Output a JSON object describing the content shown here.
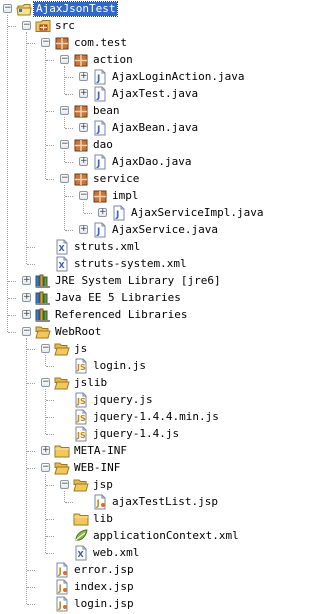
{
  "tree": {
    "items": [
      {
        "label": "AjaxJsonTest",
        "depth": 0,
        "icon": "project-icon",
        "expanded": true,
        "selected": true,
        "last": false
      },
      {
        "label": "src",
        "depth": 1,
        "icon": "source-folder-icon",
        "expanded": true,
        "last": false
      },
      {
        "label": "com.test",
        "depth": 2,
        "icon": "package-icon",
        "expanded": true,
        "last": false
      },
      {
        "label": "action",
        "depth": 3,
        "icon": "package-icon",
        "expanded": true,
        "last": false
      },
      {
        "label": "AjaxLoginAction.java",
        "depth": 4,
        "icon": "java-file-icon",
        "expanded": false,
        "last": false
      },
      {
        "label": "AjaxTest.java",
        "depth": 4,
        "icon": "java-file-icon",
        "expanded": false,
        "last": true
      },
      {
        "label": "bean",
        "depth": 3,
        "icon": "package-icon",
        "expanded": true,
        "last": false
      },
      {
        "label": "AjaxBean.java",
        "depth": 4,
        "icon": "java-file-icon",
        "expanded": false,
        "last": true
      },
      {
        "label": "dao",
        "depth": 3,
        "icon": "package-icon",
        "expanded": true,
        "last": false
      },
      {
        "label": "AjaxDao.java",
        "depth": 4,
        "icon": "java-file-icon",
        "expanded": false,
        "last": true
      },
      {
        "label": "service",
        "depth": 3,
        "icon": "package-icon",
        "expanded": true,
        "last": true
      },
      {
        "label": "impl",
        "depth": 4,
        "icon": "package-icon",
        "expanded": true,
        "last": false
      },
      {
        "label": "AjaxServiceImpl.java",
        "depth": 5,
        "icon": "java-file-icon",
        "expanded": false,
        "last": true
      },
      {
        "label": "AjaxService.java",
        "depth": 4,
        "icon": "java-file-icon",
        "expanded": false,
        "last": true
      },
      {
        "label": "struts.xml",
        "depth": 2,
        "icon": "xml-file-icon",
        "expanded": null,
        "last": false
      },
      {
        "label": "struts-system.xml",
        "depth": 2,
        "icon": "xml-file-icon",
        "expanded": null,
        "last": true
      },
      {
        "label": "JRE System Library [jre6]",
        "depth": 1,
        "icon": "library-icon",
        "expanded": false,
        "last": false
      },
      {
        "label": "Java EE 5 Libraries",
        "depth": 1,
        "icon": "library-icon",
        "expanded": false,
        "last": false
      },
      {
        "label": "Referenced Libraries",
        "depth": 1,
        "icon": "library-icon",
        "expanded": false,
        "last": false
      },
      {
        "label": "WebRoot",
        "depth": 1,
        "icon": "folder-open-icon",
        "expanded": true,
        "last": true
      },
      {
        "label": "js",
        "depth": 2,
        "icon": "folder-open-icon",
        "expanded": true,
        "last": false
      },
      {
        "label": "login.js",
        "depth": 3,
        "icon": "js-file-icon",
        "expanded": null,
        "last": true
      },
      {
        "label": "jslib",
        "depth": 2,
        "icon": "folder-open-icon",
        "expanded": true,
        "last": false
      },
      {
        "label": "jquery.js",
        "depth": 3,
        "icon": "js-file-icon",
        "expanded": null,
        "last": false
      },
      {
        "label": "jquery-1.4.4.min.js",
        "depth": 3,
        "icon": "js-file-icon",
        "expanded": null,
        "last": false
      },
      {
        "label": "jquery-1.4.js",
        "depth": 3,
        "icon": "js-file-icon",
        "expanded": null,
        "last": true
      },
      {
        "label": "META-INF",
        "depth": 2,
        "icon": "folder-icon",
        "expanded": false,
        "last": false
      },
      {
        "label": "WEB-INF",
        "depth": 2,
        "icon": "folder-open-icon",
        "expanded": true,
        "last": false
      },
      {
        "label": "jsp",
        "depth": 3,
        "icon": "folder-open-icon",
        "expanded": true,
        "last": false
      },
      {
        "label": "ajaxTestList.jsp",
        "depth": 4,
        "icon": "jsp-file-icon",
        "expanded": null,
        "last": true
      },
      {
        "label": "lib",
        "depth": 3,
        "icon": "folder-icon",
        "expanded": null,
        "last": false
      },
      {
        "label": "applicationContext.xml",
        "depth": 3,
        "icon": "spring-xml-icon",
        "expanded": null,
        "last": false
      },
      {
        "label": "web.xml",
        "depth": 3,
        "icon": "xml-file-icon",
        "expanded": null,
        "last": true
      },
      {
        "label": "error.jsp",
        "depth": 2,
        "icon": "jsp-file-icon",
        "expanded": null,
        "last": false
      },
      {
        "label": "index.jsp",
        "depth": 2,
        "icon": "jsp-file-icon",
        "expanded": null,
        "last": false
      },
      {
        "label": "login.jsp",
        "depth": 2,
        "icon": "jsp-file-icon",
        "expanded": null,
        "last": true
      }
    ]
  },
  "colors": {
    "selection": "#3169c6",
    "folder": "#f2c75c",
    "package": "#c8763a",
    "java": "#3b64c0",
    "library": "#c0a060"
  }
}
